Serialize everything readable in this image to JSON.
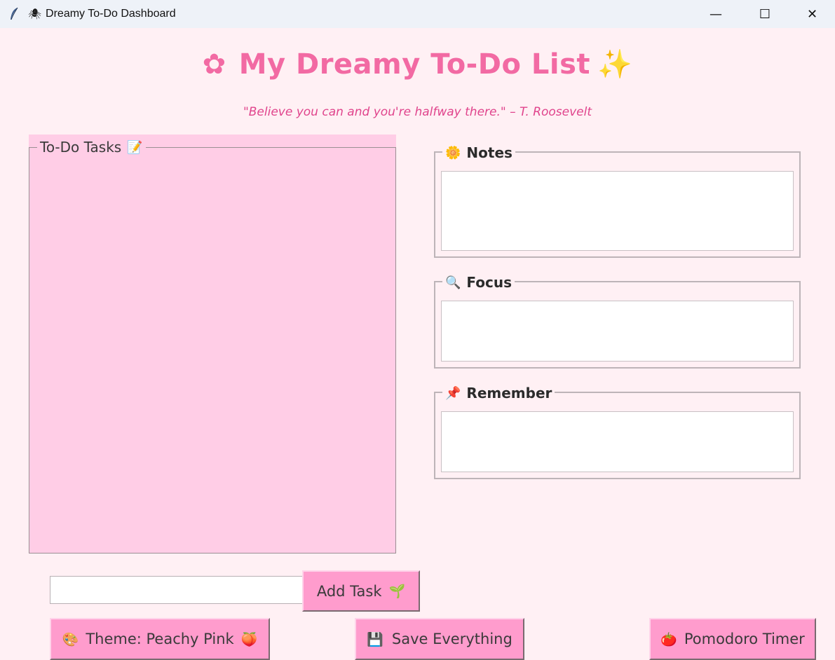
{
  "window": {
    "title_glyph": "🕷",
    "title": "Dreamy To-Do Dashboard",
    "minimize_glyph": "—",
    "maximize_glyph": "☐",
    "close_glyph": "✕"
  },
  "header": {
    "flower": "✿",
    "title": "My Dreamy To-Do List",
    "sparkle": "✨",
    "quote": "\"Believe you can and you're halfway there.\" – T. Roosevelt"
  },
  "tasks": {
    "label": "To-Do Tasks",
    "emoji": "📝",
    "items": []
  },
  "panels": {
    "notes": {
      "emoji": "🌼",
      "label": "Notes",
      "value": ""
    },
    "focus": {
      "emoji": "🔍",
      "label": "Focus",
      "value": ""
    },
    "remember": {
      "emoji": "📌",
      "label": "Remember",
      "value": ""
    }
  },
  "input": {
    "value": ""
  },
  "buttons": {
    "add_task": {
      "label": "Add Task",
      "emoji": "🌱"
    },
    "theme": {
      "lead_emoji": "🎨",
      "label": "Theme: Peachy Pink",
      "trail_emoji": "🍑"
    },
    "save": {
      "emoji": "💾",
      "label": "Save Everything"
    },
    "pomodoro": {
      "emoji": "🍅",
      "label": "Pomodoro Timer"
    }
  },
  "colors": {
    "background": "#fff0f4",
    "accent": "#f26aa3",
    "quote": "#e0448c",
    "task_area": "#ffcde6",
    "button": "#ff9ccd"
  }
}
